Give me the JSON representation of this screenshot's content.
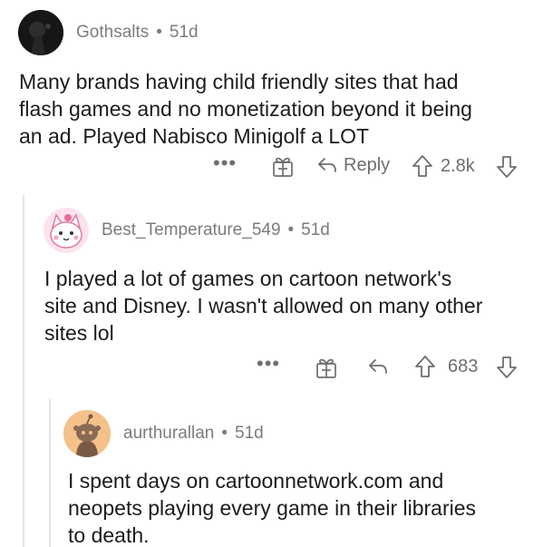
{
  "comments": [
    {
      "username": "Gothsalts",
      "separator": "•",
      "age": "51d",
      "body": "Many brands having child friendly sites that had\nflash games and no monetization beyond it being\nan ad. Played Nabisco Minigolf a LOT",
      "actions": {
        "more": "•••",
        "reply": "Reply",
        "score": "2.8k"
      }
    },
    {
      "username": "Best_Temperature_549",
      "separator": "•",
      "age": "51d",
      "body": "I played a lot of games on cartoon network's\nsite and Disney. I wasn't allowed on many other\nsites lol",
      "actions": {
        "more": "•••",
        "score": "683"
      }
    },
    {
      "username": "aurthurallan",
      "separator": "•",
      "age": "51d",
      "body": "I spent days on cartoonnetwork.com and\nneopets playing every game in their libraries\nto death."
    }
  ],
  "icons": {
    "award": "gift-box-icon",
    "reply": "reply-arrow-icon",
    "upvote": "upvote-arrow-icon",
    "downvote": "downvote-arrow-icon"
  },
  "colors": {
    "meta_text": "#7c7c7f",
    "thread_line": "#e4e4e6",
    "avatar_snoo_bg": "#f4c18a"
  }
}
